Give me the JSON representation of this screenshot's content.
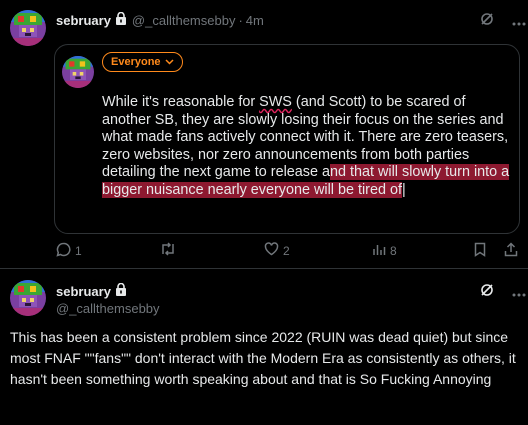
{
  "post": {
    "display_name": "sebruary",
    "handle": "@_callthemsebby",
    "time": "4m",
    "avatar_icon": "pixel-creeper-avatar"
  },
  "draft": {
    "audience_label": "Everyone",
    "text_before": "While it's reasonable for ",
    "text_sws": "SWS",
    "text_mid": " (and Scott) to be scared of another SB, they are slowly losing their focus on the series and what made fans actively connect with it. There are zero teasers, zero websites, nor zero announcements from both parties detailing the next game to release a",
    "text_selected": "nd that will slowly turn into a bigger nuisance nearly everyone will be tired of",
    "cursor": "|"
  },
  "actions": {
    "reply_count": "1",
    "like_count": "2",
    "views_count": "8"
  },
  "reply": {
    "display_name": "sebruary",
    "handle": "@_callthemsebby",
    "text": "This has been a consistent problem since 2022 (RUIN was dead quiet) but since most FNAF \"\"fans\"\" don't interact with the Modern Era as consistently as others, it hasn't been something worth speaking about and that is So Fucking Annoying"
  },
  "colors": {
    "background": "#000000",
    "audience_accent": "#ff8a1c",
    "selection": "#8d1930",
    "muted": "#71767b"
  }
}
